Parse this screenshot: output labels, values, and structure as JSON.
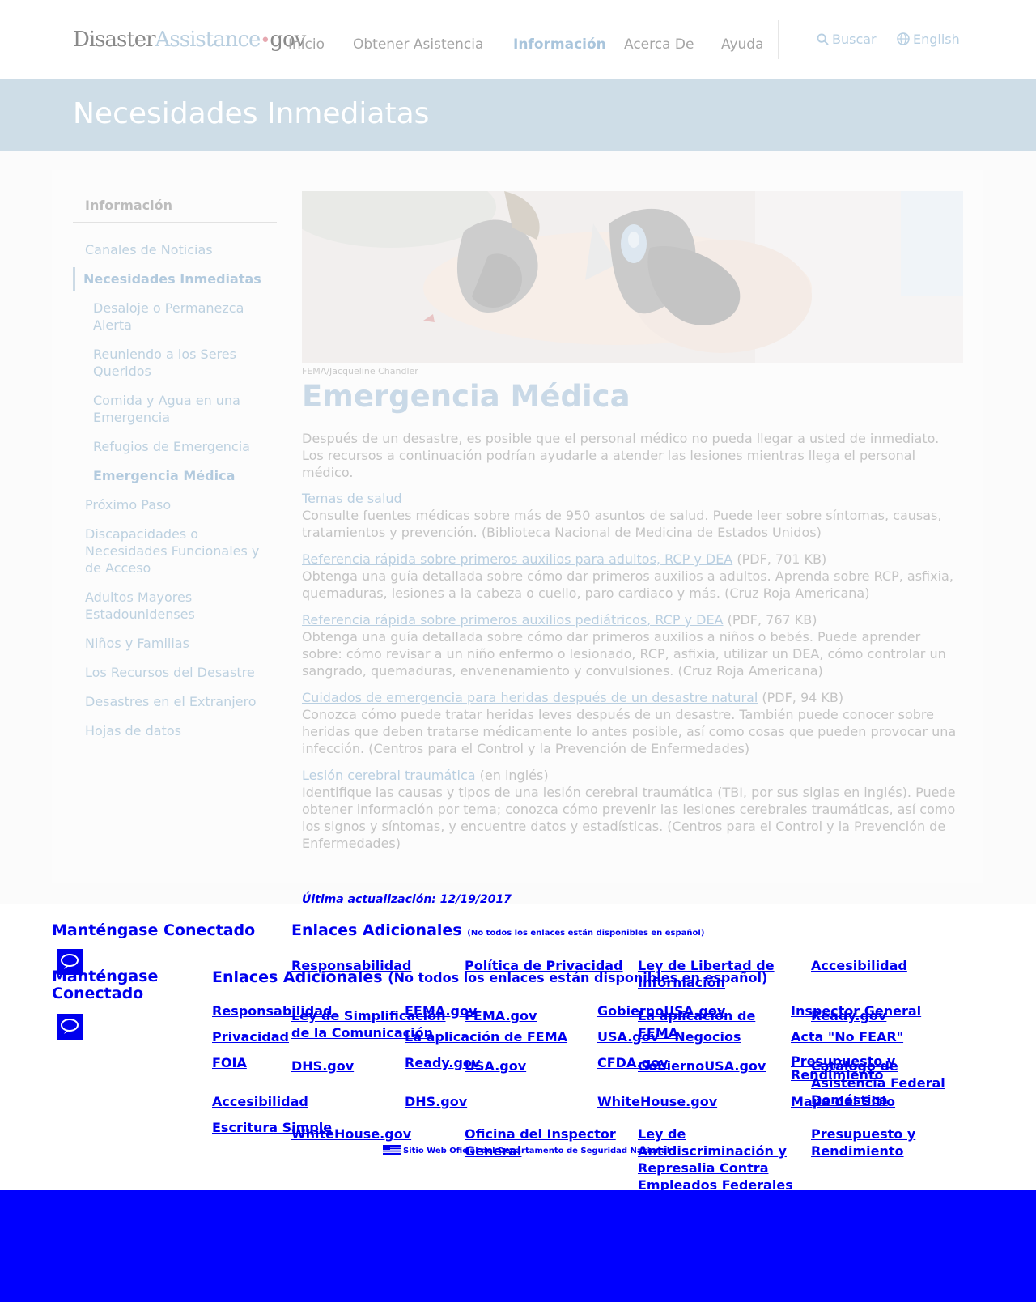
{
  "header": {
    "logo": {
      "part1": "Disaster",
      "part2": "Assistance",
      "dot": "•",
      "part3": "gov"
    },
    "nav": [
      "Inicio",
      "Obtener Asistencia",
      "Información",
      "Acerca De",
      "Ayuda"
    ],
    "search_label": "Buscar",
    "language_label": "English"
  },
  "banner": {
    "title": "Necesidades Inmediatas"
  },
  "sidebar": {
    "heading": "Información",
    "items": [
      "Canales de Noticias",
      "Necesidades Inmediatas",
      "Desaloje o Permanezca Alerta",
      "Reuniendo a los Seres Queridos",
      "Comida y Agua en una Emergencia",
      "Refugios de Emergencia",
      "Emergencia Médica",
      "Próximo Paso",
      "Discapacidades o Necesidades Funcionales y de Acceso",
      "Adultos Mayores Estadounidenses",
      "Niños y Familias",
      "Los Recursos del Desastre",
      "Desastres en el Extranjero",
      "Hojas de datos"
    ]
  },
  "article": {
    "photo_credit": "FEMA/Jacqueline Chandler",
    "title": "Emergencia Médica",
    "intro": "Después de un desastre, es posible que el personal médico no pueda llegar a usted de inmediato. Los recursos a continuación podrían ayudarle a atender las lesiones mientras llega el personal médico.",
    "resources": [
      {
        "link": "Temas de salud",
        "meta": "",
        "desc": "Consulte fuentes médicas sobre más de 950 asuntos de salud. Puede leer sobre síntomas, causas, tratamientos y prevención. (Biblioteca Nacional de Medicina de Estados Unidos)"
      },
      {
        "link": "Referencia rápida sobre primeros auxilios para adultos, RCP y DEA",
        "meta": " (PDF, 701 KB)",
        "desc": "Obtenga una guía detallada sobre cómo dar primeros auxilios a adultos. Aprenda sobre RCP, asfixia, quemaduras, lesiones a la cabeza o cuello, paro cardiaco y más. (Cruz Roja Americana)"
      },
      {
        "link": "Referencia rápida sobre primeros auxilios pediátricos, RCP y DEA",
        "meta": " (PDF, 767 KB)",
        "desc": "Obtenga una guía detallada sobre cómo dar primeros auxilios a niños o bebés. Puede aprender sobre: cómo revisar a un niño enfermo o lesionado, RCP, asfixia, utilizar un DEA, cómo controlar un sangrado, quemaduras, envenenamiento y convulsiones. (Cruz Roja Americana)"
      },
      {
        "link": "Cuidados de emergencia para heridas después de un desastre natural",
        "meta": " (PDF, 94 KB)",
        "desc": "Conozca cómo puede tratar heridas leves después de un desastre. También puede conocer sobre heridas que deben tratarse médicamente lo antes posible, así como cosas que pueden provocar una infección. (Centros para el Control y la Prevención de Enfermedades)"
      },
      {
        "link": "Lesión cerebral traumática",
        "meta": " (en inglés)",
        "desc": "Identifique las causas y tipos de una lesión cerebral traumática (TBI, por sus siglas en inglés). Puede obtener información por tema; conozca cómo prevenir las lesiones cerebrales traumáticas, así como los signos y síntomas, y encuentre datos y estadísticas. (Centros para el Control y la Prevención de Enfermedades)"
      }
    ],
    "last_updated": "Última actualización: 12/19/2017"
  },
  "footer": {
    "stay_connected": "Manténgase Conectado",
    "stay_connected_2": "Manténgase Conectado",
    "additional_links": "Enlaces Adicionales",
    "additional_note": "(No todos los enlaces están disponibles en español)",
    "additional_links_2": "Enlaces Adicionales",
    "additional_note_2": "(No todos los enlaces están disponibles en español)",
    "links_a": [
      "Responsabilidad",
      "Política de Privacidad",
      "Ley de Libertad de Información",
      "Accesibilidad",
      "Ley de Simplificación de la Comunicación",
      "FEMA.gov",
      "La aplicación de FEMA",
      "Ready.gov",
      "DHS.gov",
      "USA.gov",
      "GobiernoUSA.gov",
      "Catálogo de Asistencia Federal Doméstica",
      "WhiteHouse.gov",
      "Oficina del Inspector General",
      "Ley de Antidiscriminación y Represalia Contra Empleados Federales",
      "Presupuesto y Rendimiento"
    ],
    "links_b": [
      "Responsabilidad",
      "Privacidad",
      "FOIA",
      "Accesibilidad",
      "Escritura Simple",
      "FEMA.gov",
      "La aplicación de FEMA",
      "Ready.gov",
      "DHS.gov",
      "GobiernoUSA.gov",
      "USA.gov – Negocios",
      "CFDA.gov",
      "WhiteHouse.gov",
      "Inspector General",
      "Acta \"No FEAR\"",
      "Presupuesto y Rendimiento",
      "Mapa del Sitio"
    ],
    "official": "Sitio Web Oficial del Departamento de Seguridad Nacional"
  },
  "colors": {
    "banner": "#cedde7",
    "link_fade": "#b9cfe1",
    "footer_link": "#0000ee",
    "bottom_bar": "#0000ff"
  }
}
